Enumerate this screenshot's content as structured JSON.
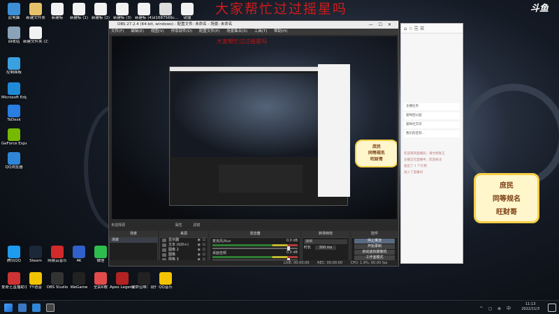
{
  "overlay": {
    "title": "大家帮忙过过摇星吗",
    "brand": "斗鱼",
    "mini_title": "大家帮忙过过摇星吗"
  },
  "desktop_icons": [
    {
      "label": "此电脑",
      "color": "#3d8fd6"
    },
    {
      "label": "新建文件夹",
      "color": "#e5c26a"
    },
    {
      "label": "新建标",
      "color": "#f2f2f2"
    },
    {
      "label": "新建标 (1)",
      "color": "#f2f2f2"
    },
    {
      "label": "新建标 (2)",
      "color": "#f2f2f2"
    },
    {
      "label": "新建标 (3)",
      "color": "#f2f2f2"
    },
    {
      "label": "新建标 (4)",
      "color": "#f2f2f2"
    },
    {
      "label": "d1687566c...",
      "color": "#dddddd"
    },
    {
      "label": "回收站",
      "color": "#8aa3b8"
    },
    {
      "label": "新建文件夹 (2)",
      "color": "#f2f2f2"
    },
    {
      "label": "控制面板",
      "color": "#3aa0e0"
    },
    {
      "label": "Microsoft Edge",
      "color": "#1f8ad6"
    },
    {
      "label": "ToDesk",
      "color": "#2a7de1"
    },
    {
      "label": "GeForce Experience",
      "color": "#76b900"
    },
    {
      "label": "QQ浏览器",
      "color": "#2f86d6"
    },
    {
      "label": "腾讯QQ",
      "color": "#1e9bee"
    },
    {
      "label": "Steam",
      "color": "#1b2838"
    },
    {
      "label": "网易云音乐",
      "color": "#d22a2a"
    },
    {
      "label": "4K",
      "color": "#3060c8"
    },
    {
      "label": "微信",
      "color": "#2dbd4e"
    },
    {
      "label": "爱奇艺直播助手",
      "color": "#cc3333"
    },
    {
      "label": "YY语音",
      "color": "#f2c400"
    },
    {
      "label": "OBS Studio",
      "color": "#333333"
    },
    {
      "label": "WeGame",
      "color": "#222222"
    },
    {
      "label": "全民K歌",
      "color": "#e14b4b"
    },
    {
      "label": "Apex Legends",
      "color": "#b22222"
    },
    {
      "label": "使命召唤：现代战争",
      "color": "#222222"
    },
    {
      "label": "QQ音乐",
      "color": "#f5c400"
    },
    {
      "label": "锐捷",
      "color": "#f2f2f2"
    }
  ],
  "obs": {
    "title": "OBS 27.2.4 (64-bit, windows) - 配置文件: 未命名 - 场景: 未命名",
    "menu": [
      "文件(F)",
      "编辑(E)",
      "视图(V)",
      "停靠部件(D)",
      "配置文件(P)",
      "场景集合(S)",
      "工具(T)",
      "帮助(H)"
    ],
    "source_props": "属性",
    "source_filter": "滤镜",
    "no_source": "未选择源",
    "docks": {
      "scenes": "场景",
      "sources": "来源",
      "mixer": "混音器",
      "transitions": "转场特效",
      "controls": "控件"
    },
    "scene_item": "场景",
    "sources": [
      "显示器",
      "文本 (GDI+)",
      "图像 2",
      "图像",
      "图像 3"
    ],
    "mixer_channels": [
      {
        "name": "麦克风/Aux",
        "db": "0.0 dB"
      },
      {
        "name": "桌面音频",
        "db": "0.0 dB"
      }
    ],
    "transition": {
      "type": "淡出",
      "duration_label": "时长",
      "duration": "300 ms"
    },
    "controls": [
      "停止推流",
      "开始录制",
      "启动虚拟摄像机",
      "工作室模式",
      "设置",
      "退出"
    ],
    "status": {
      "live": "LIVE: 00:00:00",
      "rec": "REC: 00:00:00",
      "cpu": "CPU: 1.9%, 60.00 fps"
    }
  },
  "side_panel": {
    "toolbar_icons": "⌂ ☆ ⎘ ☰",
    "items": [
      "主播任务",
      "猫咪团公园",
      "猫咪社交日",
      "我们的签到..."
    ],
    "chat_lines": [
      "欢迎来到直播间，请文明发言",
      "主播正在直播中，欢迎关注",
      "送出了 1 个礼物",
      "进入了直播间"
    ]
  },
  "sticker": {
    "line1": "庶民",
    "line2": "同等规名",
    "line3": "旺财哥"
  },
  "taskbar": {
    "time": "11:13",
    "date": "2022/11/3",
    "tray_text": "^ ◻ ⊕ 中"
  }
}
